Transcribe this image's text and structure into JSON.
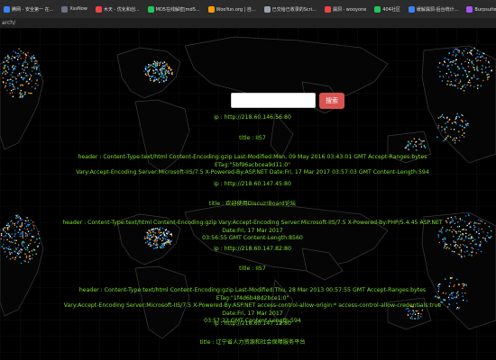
{
  "bookmarks": [
    {
      "label": "腾网 - 安全第一 在...",
      "color": "#3b82f6"
    },
    {
      "label": "XssNow",
      "color": "#6b7280"
    },
    {
      "label": "木天 - 优化和创...",
      "color": "#ef4444"
    },
    {
      "label": "MD5在线解密|md5...",
      "color": "#22c55e"
    },
    {
      "label": "WooYun.org | 自...",
      "color": "#f59e0b"
    },
    {
      "label": "已交给已收录的Scri...",
      "color": "#9ca3af"
    },
    {
      "label": "漏洞 - wooyone",
      "color": "#ef4444"
    },
    {
      "label": "404社区",
      "color": "#22c55e"
    },
    {
      "label": "缓解漏洞-后台统计...",
      "color": "#3b82f6"
    },
    {
      "label": "Burpsuite之四个...",
      "color": "#a855f7"
    }
  ],
  "address": "arch/",
  "search": {
    "placeholder": "",
    "value": "",
    "button": "搜索"
  },
  "results": [
    {
      "lines": [
        "ip : http://218.60.146.56:80"
      ]
    },
    {
      "lines": [
        "title : IIS7"
      ]
    },
    {
      "lines": [
        "header : Content-Type:text/html Content-Encoding:gzip Last-Modified:Mon, 09 May 2016 03:43:01 GMT Accept-Ranges:bytes ETag:\"5bf96acbcea9d11:0\"",
        "Vary:Accept-Encoding Server:Microsoft-IIS/7.5 X-Powered-By:ASP.NET Date:Fri, 17 Mar 2017 03:57:03 GMT Content-Length:594"
      ]
    },
    {
      "lines": [
        "ip : http://218.60.147.45:80"
      ]
    },
    {
      "lines": [
        "title : 欢迎使用Discuz!Board论坛"
      ]
    },
    {
      "lines": [
        "header : Content-Type:text/html Content-Encoding:gzip Vary:Accept-Encoding Server:Microsoft-IIS/7.5 X-Powered-By:PHP/5.4.45 ASP.NET Date:Fri, 17 Mar 2017",
        "03:56:55 GMT Content-Length:8560"
      ]
    },
    {
      "lines": [
        "ip : http://218.60.147.82:80"
      ]
    },
    {
      "lines": [
        "title : IIS7"
      ]
    },
    {
      "lines": [
        "header : Content-Type:text/html Content-Encoding:gzip Last-Modified:Thu, 28 Mar 2013 00:57:55 GMT Accept-Ranges:bytes ETag:\"1f4d6b48d2bce1:0\"",
        "Vary:Accept-Encoding Server:Microsoft-IIS/7.5 X-Powered-By:ASP.NET access-control-allow-origin:* access-control-allow-credentials:true Date:Fri, 17 Mar 2017",
        "03:57:22 GMT Content-Length:594"
      ]
    },
    {
      "lines": [
        "ip : http://218.60.147.12:80"
      ]
    },
    {
      "lines": [
        "title : 辽宁省人力资源和社会保障服务平台"
      ]
    }
  ],
  "colors": {
    "result_text": "#7ddd30",
    "search_button": "#d9534f",
    "map_ocean": "#000000"
  }
}
